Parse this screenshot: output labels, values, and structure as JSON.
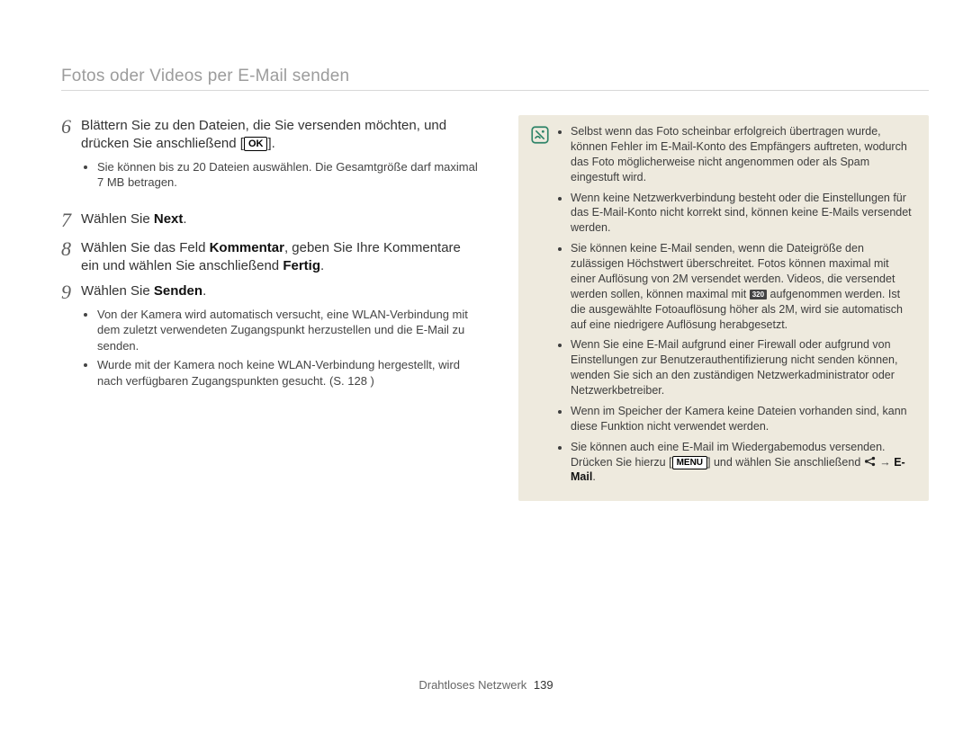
{
  "header": {
    "title": "Fotos oder Videos per E-Mail senden"
  },
  "steps": {
    "s6": {
      "num": "6",
      "text_a": "Blättern Sie zu den Dateien, die Sie versenden möchten, und drücken Sie anschließend [",
      "ok": "OK",
      "text_b": "].",
      "bullet1": "Sie können bis zu 20 Dateien auswählen. Die Gesamtgröße darf maximal 7 MB betragen."
    },
    "s7": {
      "num": "7",
      "text_a": "Wählen Sie ",
      "bold_a": "Next",
      "text_b": "."
    },
    "s8": {
      "num": "8",
      "text_a": "Wählen Sie das Feld ",
      "bold_a": "Kommentar",
      "text_b": ", geben Sie Ihre Kommentare ein und wählen Sie anschließend ",
      "bold_b": "Fertig",
      "text_c": "."
    },
    "s9": {
      "num": "9",
      "text_a": "Wählen Sie ",
      "bold_a": "Senden",
      "text_b": ".",
      "bullet1": "Von der Kamera wird automatisch versucht, eine WLAN-Verbindung mit dem zuletzt verwendeten Zugangspunkt herzustellen und die E-Mail zu senden.",
      "bullet2": "Wurde mit der Kamera noch keine WLAN-Verbindung hergestellt, wird nach verfügbaren Zugangspunkten gesucht. (S. 128 )"
    }
  },
  "notes": {
    "n1": "Selbst wenn das Foto scheinbar erfolgreich übertragen wurde, können Fehler im E-Mail-Konto des Empfängers auftreten, wodurch das Foto möglicherweise nicht angenommen oder als Spam eingestuft wird.",
    "n2": "Wenn keine Netzwerkverbindung besteht oder die Einstellungen für das E-Mail-Konto nicht korrekt sind, können keine E-Mails versendet werden.",
    "n3_a": "Sie können keine E-Mail senden, wenn die Dateigröße den zulässigen Höchstwert überschreitet. Fotos können maximal mit einer Auflösung von 2M versendet werden. Videos, die versendet werden sollen, können maximal mit ",
    "n3_res": "320",
    "n3_b": " aufgenommen werden. Ist die ausgewählte Fotoauflösung höher als 2M, wird sie automatisch auf eine niedrigere Auflösung herabgesetzt.",
    "n4": "Wenn Sie eine E-Mail aufgrund einer Firewall oder aufgrund von Einstellungen zur Benutzerauthentifizierung nicht senden können, wenden Sie sich an den zuständigen Netzwerkadministrator oder Netzwerkbetreiber.",
    "n5": "Wenn im Speicher der Kamera keine Dateien vorhanden sind, kann diese Funktion nicht verwendet werden.",
    "n6_a": "Sie können auch eine E-Mail im Wiedergabemodus versenden. Drücken Sie hierzu [",
    "n6_menu": "MENU",
    "n6_b": "] und wählen Sie anschließend ",
    "n6_c": " → ",
    "n6_bold": "E-Mail",
    "n6_d": "."
  },
  "footer": {
    "section": "Drahtloses Netzwerk",
    "page": "139"
  }
}
